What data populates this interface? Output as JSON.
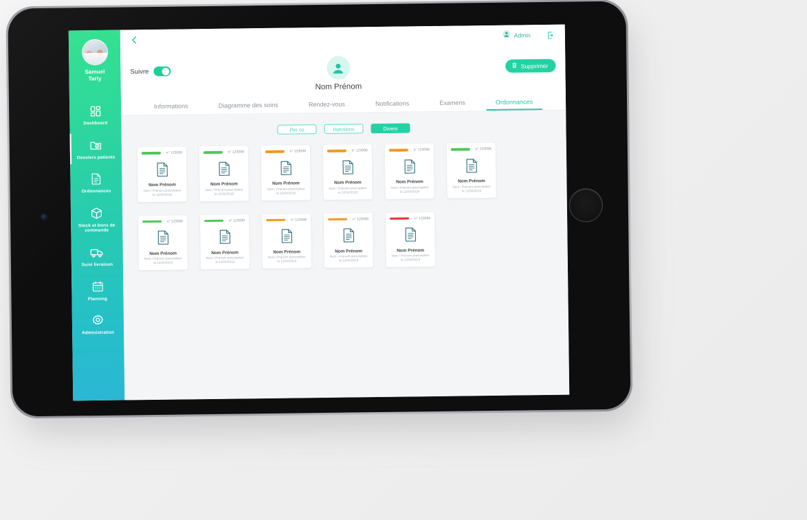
{
  "sidebar": {
    "user": {
      "name_line1": "Samuel",
      "name_line2": "Tarly",
      "avatar_icon": "user-photo"
    },
    "items": [
      {
        "label": "Dashboard",
        "icon": "dashboard-icon",
        "active": false
      },
      {
        "label": "Dossiers patients",
        "icon": "folder-patient-icon",
        "active": true
      },
      {
        "label": "Ordonnances",
        "icon": "prescription-document-icon",
        "active": false
      },
      {
        "label": "Stock et bons de commande",
        "icon": "box-icon",
        "active": false
      },
      {
        "label": "Suivi livraison",
        "icon": "truck-icon",
        "active": false
      },
      {
        "label": "Planning",
        "icon": "calendar-icon",
        "active": false
      },
      {
        "label": "Administration",
        "icon": "gear-icon",
        "active": false
      }
    ],
    "gradient_from": "#2ee08c",
    "gradient_to": "#2ab7d4"
  },
  "topbar": {
    "back_icon": "chevron-left-icon",
    "admin_label": "Admin",
    "admin_icon": "user-circle-icon",
    "logout_icon": "logout-icon"
  },
  "patient_header": {
    "follow_label": "Suivre",
    "follow_enabled": true,
    "avatar_icon": "user-avatar-icon",
    "name": "Nom Prénom",
    "delete_label": "Supprimer",
    "delete_icon": "trash-icon"
  },
  "tabs": [
    {
      "label": "Informations",
      "active": false
    },
    {
      "label": "Diagramme des soins",
      "active": false
    },
    {
      "label": "Rendez-vous",
      "active": false
    },
    {
      "label": "Notifications",
      "active": false
    },
    {
      "label": "Examens",
      "active": false
    },
    {
      "label": "Ordonnances",
      "active": true
    }
  ],
  "filters": [
    {
      "label": "Per os",
      "active": false
    },
    {
      "label": "Injections",
      "active": false
    },
    {
      "label": "Divers",
      "active": true
    }
  ],
  "colors": {
    "accent": "#23d2a4",
    "status_green": "#4cc85b",
    "status_orange": "#f3981d",
    "status_red": "#e8322a",
    "doc_icon": "#2f6f7e"
  },
  "cards": [
    {
      "status": "green",
      "number": "n° 123098",
      "name": "Nom Prénom",
      "prescriber": "Nom / Prénom prescripteur",
      "date": "le 12/04/2019"
    },
    {
      "status": "green",
      "number": "n° 123098",
      "name": "Nom Prénom",
      "prescriber": "Nom / Prénom prescripteur",
      "date": "le 12/04/2019"
    },
    {
      "status": "orange",
      "number": "n° 123098",
      "name": "Nom Prénom",
      "prescriber": "Nom / Prénom prescripteur",
      "date": "le 12/04/2019"
    },
    {
      "status": "orange",
      "number": "n° 123098",
      "name": "Nom Prénom",
      "prescriber": "Nom / Prénom prescripteur",
      "date": "le 12/04/2019"
    },
    {
      "status": "orange",
      "number": "n° 123098",
      "name": "Nom Prénom",
      "prescriber": "Nom / Prénom prescripteur",
      "date": "le 12/04/2019"
    },
    {
      "status": "green",
      "number": "n° 123098",
      "name": "Nom Prénom",
      "prescriber": "Nom / Prénom prescripteur",
      "date": "le 12/04/2019"
    },
    {
      "status": "green",
      "number": "n° 123098",
      "name": "Nom Prénom",
      "prescriber": "Nom / Prénom prescripteur",
      "date": "le 12/04/2019"
    },
    {
      "status": "green",
      "number": "n° 123098",
      "name": "Nom Prénom",
      "prescriber": "Nom / Prénom prescripteur",
      "date": "le 12/04/2019"
    },
    {
      "status": "orange",
      "number": "n° 123098",
      "name": "Nom Prénom",
      "prescriber": "Nom / Prénom prescripteur",
      "date": "le 12/04/2019"
    },
    {
      "status": "orange",
      "number": "n° 123098",
      "name": "Nom Prénom",
      "prescriber": "Nom / Prénom prescripteur",
      "date": "le 12/04/2019"
    },
    {
      "status": "red",
      "number": "n° 123098",
      "name": "Nom Prénom",
      "prescriber": "Nom / Prénom prescripteur",
      "date": "le 12/04/2019"
    }
  ]
}
